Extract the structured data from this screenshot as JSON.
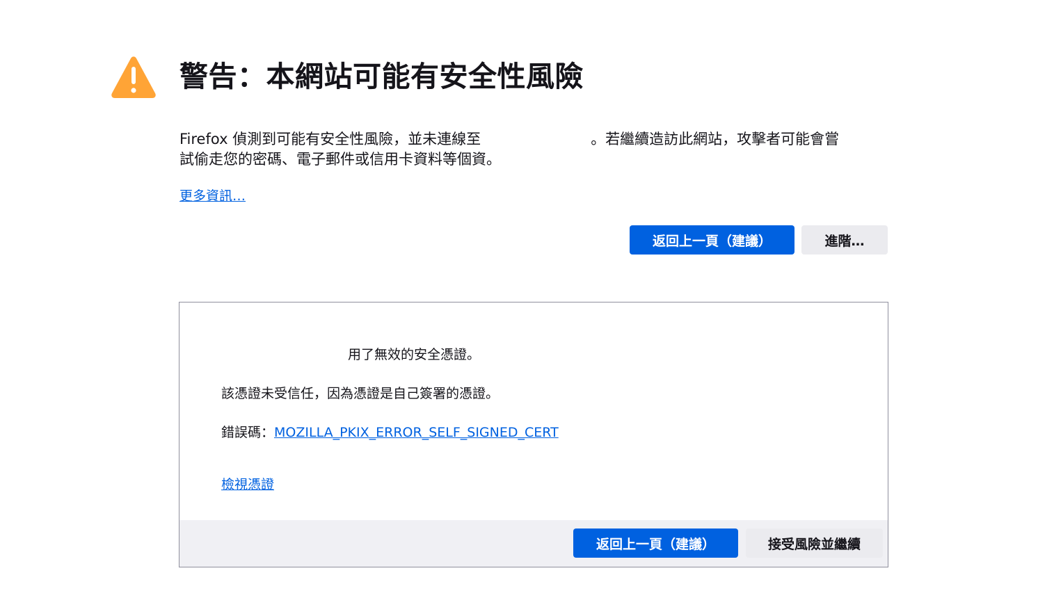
{
  "header": {
    "title": "警告：本網站可能有安全性風險",
    "icon": "warning-triangle-icon",
    "icon_color": "#ffa436"
  },
  "description": {
    "line1_start": "Firefox 偵測到可能有安全性風險，並未連線至",
    "line1_end": "。若繼續造訪此網站，攻擊者可能會嘗",
    "line2": "試偷走您的密碼、電子郵件或信用卡資料等個資。"
  },
  "learn_more_label": "更多資訊…",
  "actions": {
    "go_back_label": "返回上一頁（建議）",
    "advanced_label": "進階…"
  },
  "advanced_panel": {
    "invalid_cert_text": "用了無效的安全憑證。",
    "untrusted_text": "該憑證未受信任，因為憑證是自己簽署的憑證。",
    "error_code_label": "錯誤碼：",
    "error_code": "MOZILLA_PKIX_ERROR_SELF_SIGNED_CERT",
    "view_certificate_label": "檢視憑證",
    "go_back_label": "返回上一頁（建議）",
    "accept_label": "接受風險並繼續"
  },
  "colors": {
    "primary_button": "#0061e0",
    "secondary_button": "#ebebef",
    "link": "#0061e0",
    "panel_footer": "#f0f0f4"
  }
}
